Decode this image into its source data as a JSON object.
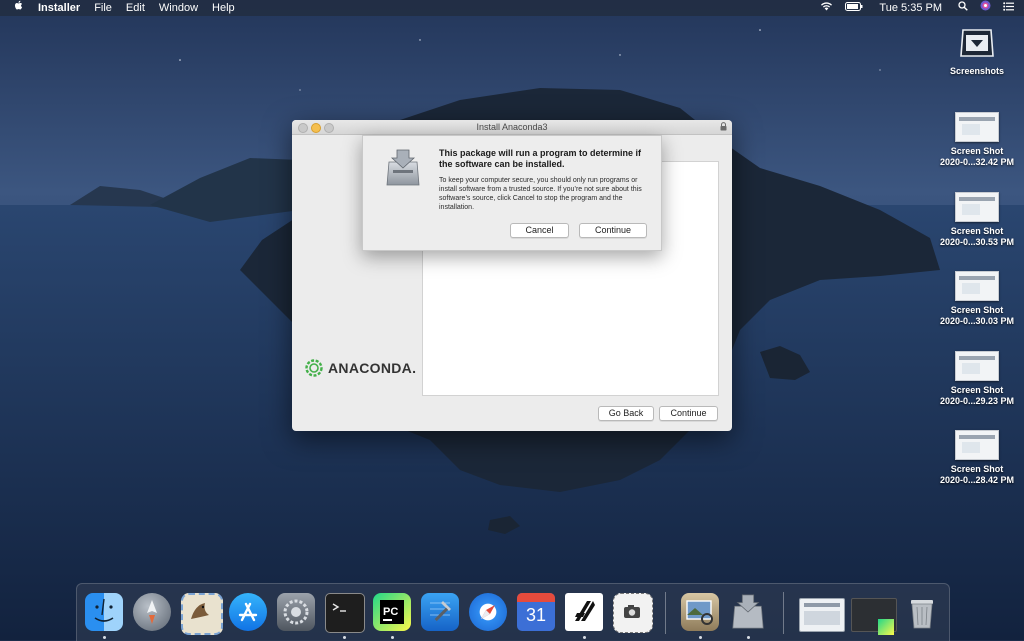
{
  "menubar": {
    "apple_icon": "apple-icon",
    "app_name": "Installer",
    "menus": [
      "File",
      "Edit",
      "Window",
      "Help"
    ],
    "clock": "Tue 5:35 PM",
    "status_icons": [
      "wifi-icon",
      "battery-icon",
      "spotlight-icon",
      "siri-icon",
      "notification-center-icon"
    ]
  },
  "desktop": {
    "items": [
      {
        "line1": "Screenshots",
        "line2": "",
        "icon": "folder-icon"
      },
      {
        "line1": "Screen Shot",
        "line2": "2020-0...32.42 PM",
        "icon": "screenshot-thumbnail"
      },
      {
        "line1": "Screen Shot",
        "line2": "2020-0...30.53 PM",
        "icon": "screenshot-thumbnail"
      },
      {
        "line1": "Screen Shot",
        "line2": "2020-0...30.03 PM",
        "icon": "screenshot-thumbnail"
      },
      {
        "line1": "Screen Shot",
        "line2": "2020-0...29.23 PM",
        "icon": "screenshot-thumbnail"
      },
      {
        "line1": "Screen Shot",
        "line2": "2020-0...28.42 PM",
        "icon": "screenshot-thumbnail"
      }
    ]
  },
  "installer": {
    "title": "Install Anaconda3",
    "logo_text": "ANACONDA",
    "logo_suffix": ".",
    "go_back": "Go Back",
    "continue": "Continue"
  },
  "alert": {
    "title": "This package will run a program to determine if the software can be installed.",
    "body": "To keep your computer secure, you should only run programs or install software from a trusted source. If you’re not sure about this software’s source, click Cancel to stop the program and the installation.",
    "cancel": "Cancel",
    "continue": "Continue",
    "icon": "installer-package-icon"
  },
  "dock": {
    "apps": [
      {
        "name": "Finder",
        "icon": "finder-icon",
        "running": true
      },
      {
        "name": "Launchpad",
        "icon": "launchpad-icon",
        "running": false
      },
      {
        "name": "Mail",
        "icon": "mail-icon",
        "running": false
      },
      {
        "name": "App Store",
        "icon": "app-store-icon",
        "running": false
      },
      {
        "name": "System Preferences",
        "icon": "system-preferences-icon",
        "running": false
      },
      {
        "name": "Terminal",
        "icon": "terminal-icon",
        "running": true
      },
      {
        "name": "PyCharm",
        "icon": "pycharm-icon",
        "running": true
      },
      {
        "name": "Xcode",
        "icon": "xcode-icon",
        "running": false
      },
      {
        "name": "Safari",
        "icon": "safari-icon",
        "running": false
      },
      {
        "name": "Calendar",
        "icon": "calendar-icon",
        "label": "31",
        "running": false
      },
      {
        "name": "Code app",
        "icon": "code-app-icon",
        "running": true
      },
      {
        "name": "Screenshot",
        "icon": "screenshot-app-icon",
        "running": false
      },
      {
        "name": "Preview",
        "icon": "preview-icon",
        "running": true
      },
      {
        "name": "Installer",
        "icon": "installer-icon",
        "running": true
      },
      {
        "name": "Window thumbnail 1",
        "icon": "window-thumbnail",
        "running": false
      },
      {
        "name": "Window thumbnail 2",
        "icon": "window-thumbnail",
        "running": false
      },
      {
        "name": "Trash",
        "icon": "trash-icon",
        "running": false
      }
    ]
  },
  "colors": {
    "wallpaper_sky": "#3a527a",
    "wallpaper_sea": "#1c3153",
    "anaconda_green": "#43b049",
    "close": "#c9c9c9",
    "minimize": "#f5bf4f"
  }
}
